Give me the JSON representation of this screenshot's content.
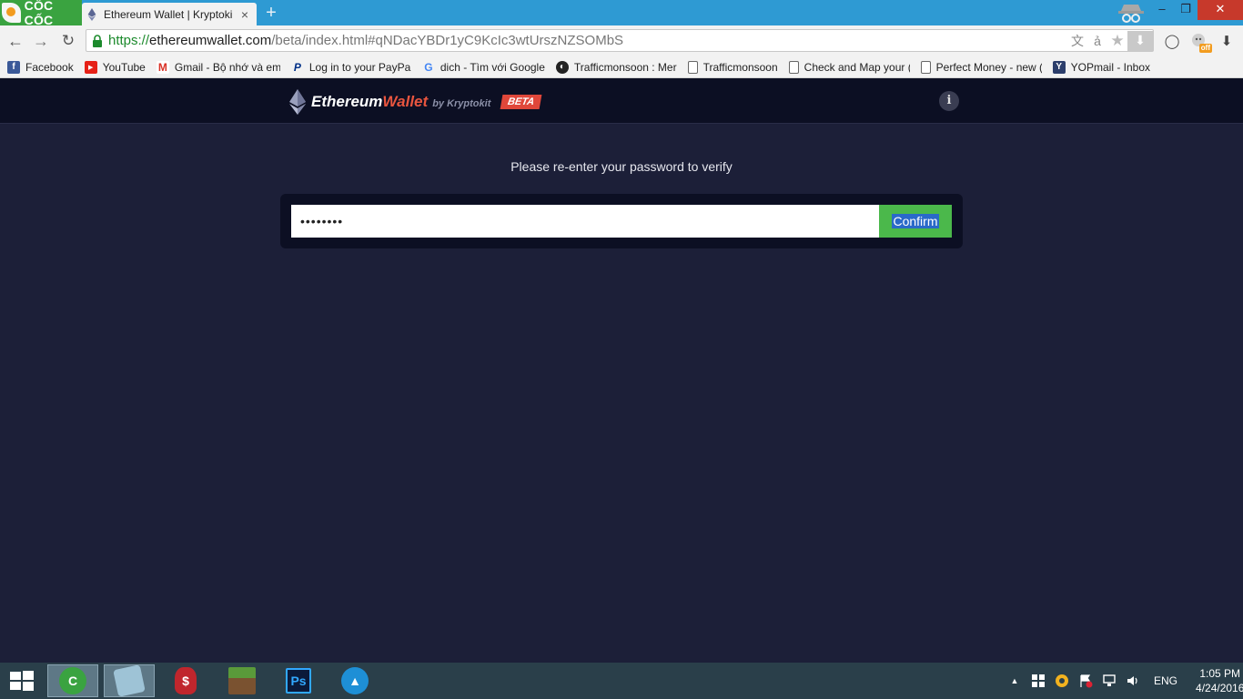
{
  "browser": {
    "brand": "CỐC CỐC",
    "tab": {
      "title": "Ethereum Wallet | Kryptoki",
      "close": "×"
    },
    "new_tab": "+",
    "window": {
      "minimize": "–",
      "maximize": "❐",
      "close": "✕"
    },
    "nav": {
      "back": "←",
      "forward": "→",
      "reload": "↻"
    },
    "url": {
      "scheme": "https://",
      "host": "ethereumwallet.com",
      "path": "/beta/index.html#qNDacYBDr1yC9KcIc3wtUrszNZSOMbS"
    },
    "omni_icons": {
      "translate": "文",
      "text": "ả",
      "star": "★",
      "download": "⬇"
    },
    "ext_icons": {
      "opera": "◯",
      "adblock": "off",
      "downloads": "⬇"
    },
    "bookmarks": [
      {
        "label": "Facebook",
        "icon": "f",
        "color": "#3b5998"
      },
      {
        "label": "YouTube",
        "icon": "▶",
        "color": "#e62117"
      },
      {
        "label": "Gmail - Bộ nhớ và em",
        "icon": "M",
        "color": "#d93025"
      },
      {
        "label": "Log in to your PayPal",
        "icon": "P",
        "color": "#003087"
      },
      {
        "label": "dich - Tìm với Google",
        "icon": "G",
        "color": "#4285f4"
      },
      {
        "label": "Trafficmonsoon : Mer",
        "icon": "◐",
        "color": "#222222"
      },
      {
        "label": "Trafficmonsoon",
        "icon": "",
        "color": "#ffffff"
      },
      {
        "label": "Check and Map your (",
        "icon": "",
        "color": "#ffffff"
      },
      {
        "label": "Perfect Money - new (",
        "icon": "",
        "color": "#ffffff"
      },
      {
        "label": "YOPmail - Inbox",
        "icon": "Y",
        "color": "#2c3e6b"
      }
    ]
  },
  "app": {
    "brand": {
      "part1": "Ethereum",
      "part2": "Wallet",
      "by": "by Kryptokit",
      "beta": "BETA"
    },
    "info_label": "i",
    "prompt": "Please re-enter your password to verify",
    "password_value": "••••••••",
    "confirm_label": "Confirm"
  },
  "taskbar": {
    "apps": [
      {
        "name": "coccoc-browser",
        "label": "C",
        "color": "#3aa340",
        "active": true
      },
      {
        "name": "notepad",
        "label": "",
        "color": "#9ec3d6",
        "active": true
      },
      {
        "name": "red-bag-app",
        "label": "$",
        "color": "#c0262d",
        "active": false
      },
      {
        "name": "minecraft",
        "label": "",
        "color": "#5a8a3a",
        "active": false
      },
      {
        "name": "photoshop",
        "label": "Ps",
        "color": "#0b1a3a",
        "active": false
      },
      {
        "name": "arc-app",
        "label": "▲",
        "color": "#1e8fd6",
        "active": false
      }
    ],
    "tray": {
      "chevron": "▲",
      "lang": "ENG",
      "time": "1:05 PM",
      "date": "4/24/2016"
    }
  },
  "colors": {
    "app_bg": "#1c1f38",
    "header_bg": "#0c0f23",
    "accent": "#e0473a",
    "confirm": "#4bb84b",
    "browser_tab_bar": "#2e9ad3"
  }
}
